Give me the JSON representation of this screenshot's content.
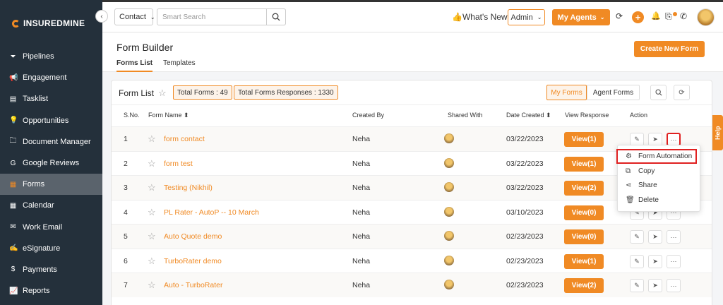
{
  "brand": {
    "name": "INSUREDMINE",
    "accent": "#f08a24"
  },
  "sidebar": {
    "items": [
      {
        "label": "Pipelines",
        "icon": "filter-icon",
        "glyph": "⏷"
      },
      {
        "label": "Engagement",
        "icon": "megaphone-icon",
        "glyph": "📢"
      },
      {
        "label": "Tasklist",
        "icon": "clipboard-icon",
        "glyph": "▤"
      },
      {
        "label": "Opportunities",
        "icon": "lightbulb-icon",
        "glyph": "💡"
      },
      {
        "label": "Document Manager",
        "icon": "folder-icon",
        "glyph": "🗀"
      },
      {
        "label": "Google Reviews",
        "icon": "google-icon",
        "glyph": "G"
      },
      {
        "label": "Forms",
        "icon": "forms-icon",
        "glyph": "▦"
      },
      {
        "label": "Calendar",
        "icon": "calendar-icon",
        "glyph": "▦"
      },
      {
        "label": "Work Email",
        "icon": "envelope-icon",
        "glyph": "✉"
      },
      {
        "label": "eSignature",
        "icon": "signature-icon",
        "glyph": "✍"
      },
      {
        "label": "Payments",
        "icon": "dollar-icon",
        "glyph": "$"
      },
      {
        "label": "Reports",
        "icon": "chart-icon",
        "glyph": "📈"
      }
    ],
    "active": "Forms"
  },
  "topbar": {
    "entity_select": "Contact",
    "search_placeholder": "Smart Search",
    "whats_new": "👍What's New",
    "role_select": "Admin",
    "agents_button": "My Agents"
  },
  "header": {
    "title": "Form Builder",
    "tabs": [
      "Forms List",
      "Templates"
    ],
    "create_button": "Create New Form"
  },
  "card": {
    "title": "Form List",
    "total_forms": "Total Forms : 49",
    "total_responses": "Total Forms Responses : 1330",
    "filter_my": "My Forms",
    "filter_agent": "Agent Forms"
  },
  "table": {
    "headers": [
      "S.No.",
      "Form Name ⬍",
      "Created By",
      "Shared With",
      "Date Created ⬍",
      "View Response",
      "Action"
    ],
    "rows": [
      {
        "sno": "1",
        "name": "form contact",
        "by": "Neha",
        "date": "03/22/2023",
        "view": "View(1)"
      },
      {
        "sno": "2",
        "name": "form test",
        "by": "Neha",
        "date": "03/22/2023",
        "view": "View(1)"
      },
      {
        "sno": "3",
        "name": "Testing (Nikhil)",
        "by": "Neha",
        "date": "03/22/2023",
        "view": "View(2)"
      },
      {
        "sno": "4",
        "name": "PL Rater - AutoP -- 10 March",
        "by": "Neha",
        "date": "03/10/2023",
        "view": "View(0)"
      },
      {
        "sno": "5",
        "name": "Auto Quote demo",
        "by": "Neha",
        "date": "02/23/2023",
        "view": "View(0)"
      },
      {
        "sno": "6",
        "name": "TurboRater demo",
        "by": "Neha",
        "date": "02/23/2023",
        "view": "View(1)"
      },
      {
        "sno": "7",
        "name": "Auto - TurboRater",
        "by": "Neha",
        "date": "02/23/2023",
        "view": "View(2)"
      }
    ]
  },
  "action_menu": {
    "items": [
      {
        "label": "Form Automation",
        "icon": "gear-icon",
        "glyph": "⚙"
      },
      {
        "label": "Copy",
        "icon": "copy-icon",
        "glyph": "⧉"
      },
      {
        "label": "Share",
        "icon": "share-icon",
        "glyph": "⋖"
      },
      {
        "label": "Delete",
        "icon": "trash-icon",
        "glyph": "🗑"
      }
    ]
  },
  "help_tab": "Help"
}
